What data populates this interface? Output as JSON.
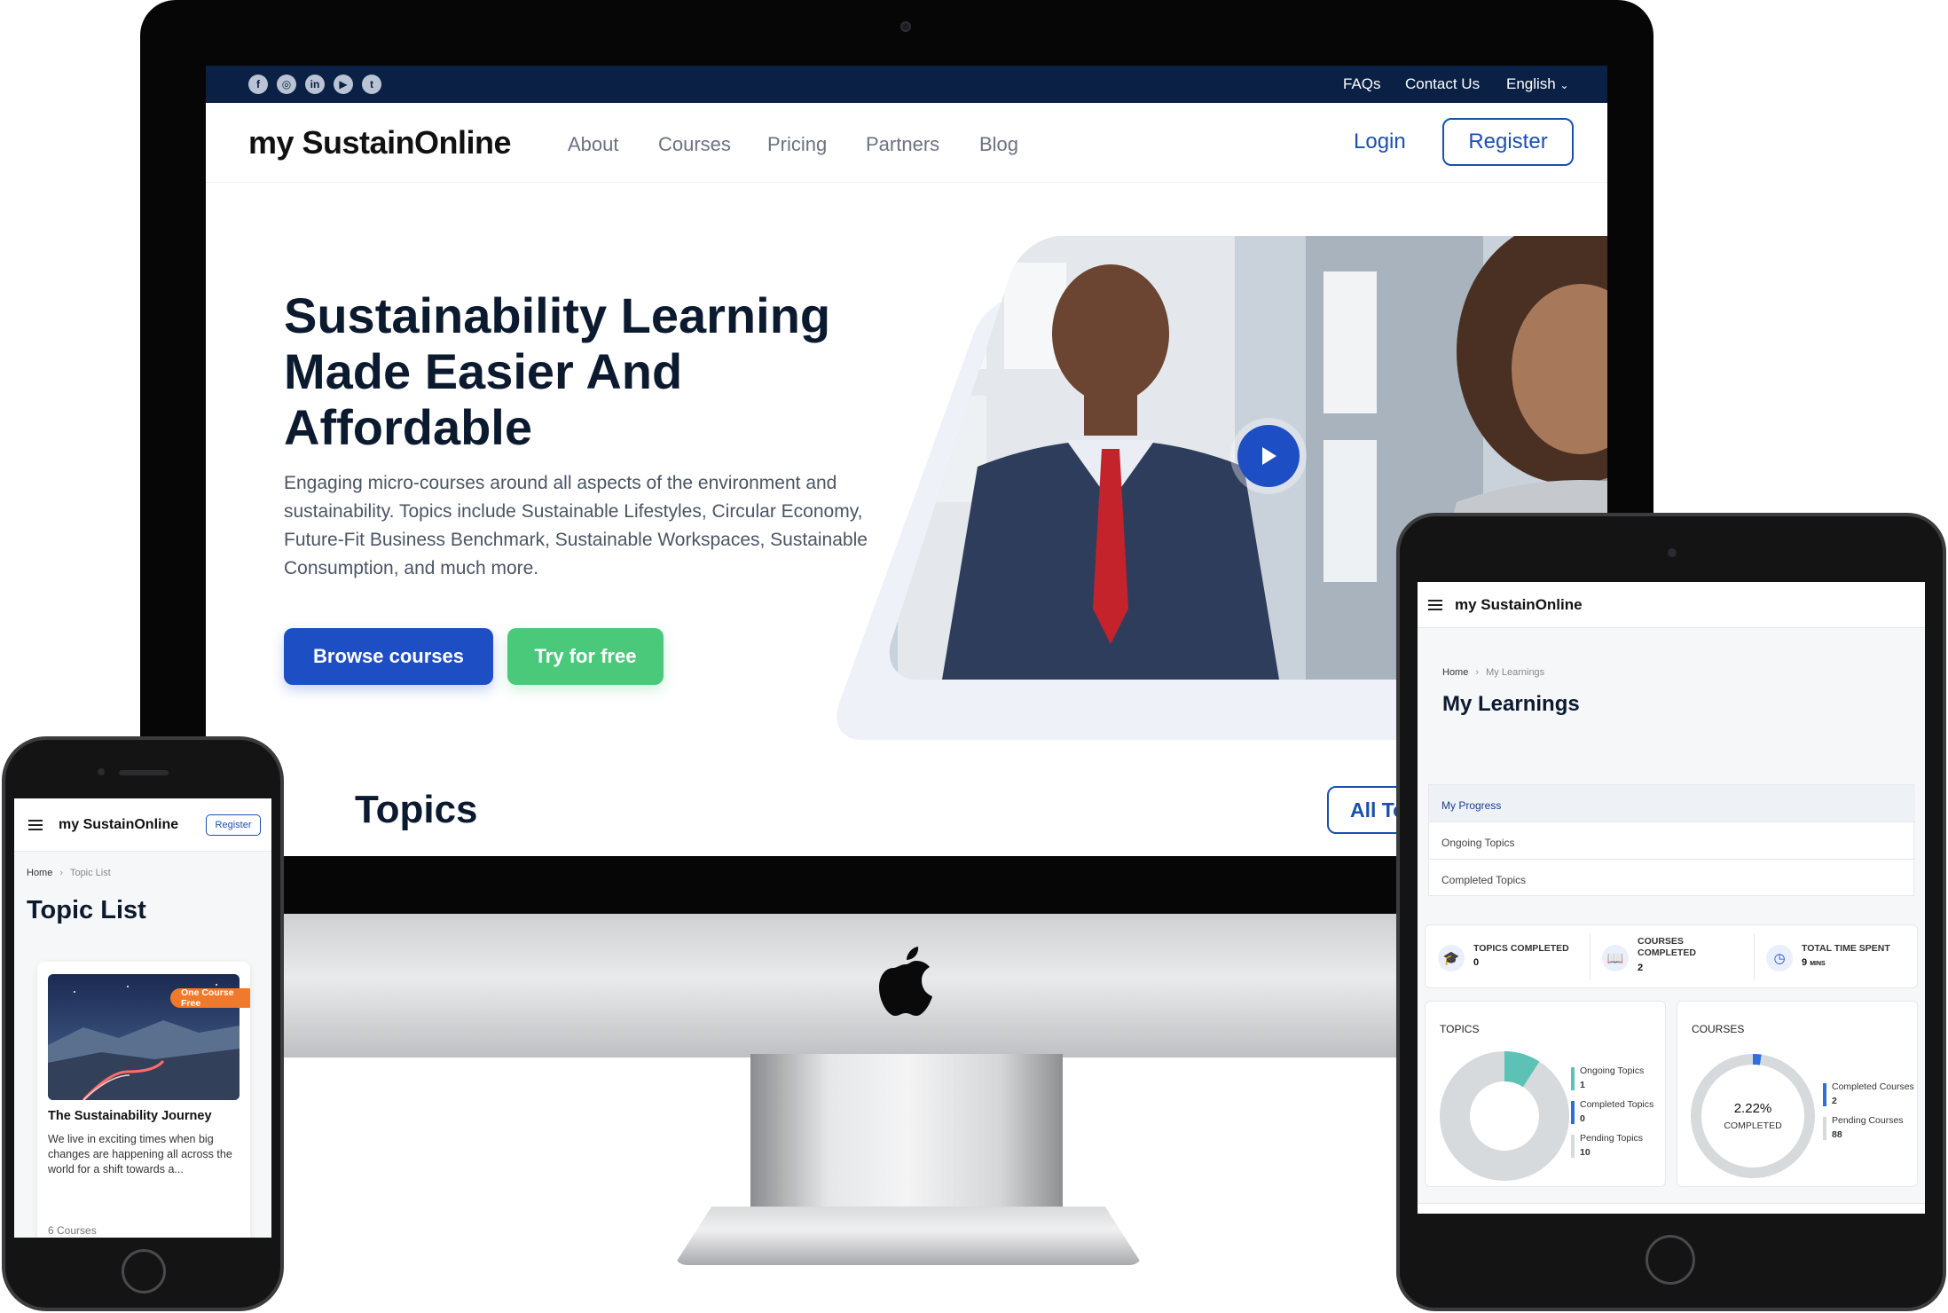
{
  "desktop": {
    "topbar": {
      "social_icons": [
        "facebook-icon",
        "instagram-icon",
        "linkedin-icon",
        "youtube-icon",
        "twitter-icon"
      ],
      "links": [
        "FAQs",
        "Contact Us"
      ],
      "language": "English"
    },
    "nav": {
      "brand": "my SustainOnline",
      "items": [
        "About",
        "Courses",
        "Pricing",
        "Partners",
        "Blog"
      ],
      "login": "Login",
      "register": "Register"
    },
    "hero": {
      "title": "Sustainability Learning Made Easier And Affordable",
      "description": "Engaging micro-courses around all aspects of the environment and sustainability. Topics include Sustainable Lifestyles, Circular Economy, Future-Fit Business Benchmark, Sustainable Workspaces, Sustainable Consumption, and much more.",
      "browse_button": "Browse courses",
      "try_button": "Try for free"
    },
    "topics": {
      "heading": "Topics",
      "all_button": "All To"
    }
  },
  "tablet": {
    "brand": "my SustainOnline",
    "breadcrumb": [
      "Home",
      "My Learnings"
    ],
    "title": "My Learnings",
    "tabs": [
      "My Progress",
      "Ongoing Topics",
      "Completed Topics"
    ],
    "stats": [
      {
        "label": "TOPICS COMPLETED",
        "value": "0",
        "unit": ""
      },
      {
        "label": "COURSES COMPLETED",
        "value": "2",
        "unit": ""
      },
      {
        "label": "TOTAL TIME SPENT",
        "value": "9",
        "unit": "MINS"
      }
    ],
    "topics_card": {
      "title": "TOPICS",
      "legend": [
        {
          "label": "Ongoing Topics",
          "value": "1",
          "color": "#5cc2b5"
        },
        {
          "label": "Completed Topics",
          "value": "0",
          "color": "#2f6fd6"
        },
        {
          "label": "Pending Topics",
          "value": "10",
          "color": "#d6dadd"
        }
      ]
    },
    "courses_card": {
      "title": "COURSES",
      "center_value": "2.22%",
      "center_label": "COMPLETED",
      "legend": [
        {
          "label": "Completed Courses",
          "value": "2",
          "color": "#2f6fd6"
        },
        {
          "label": "Pending Courses",
          "value": "88",
          "color": "#d6dadd"
        }
      ]
    }
  },
  "phone": {
    "brand": "my SustainOnline",
    "register": "Register",
    "breadcrumb": [
      "Home",
      "Topic List"
    ],
    "title": "Topic List",
    "card": {
      "badge": "One Course Free",
      "title": "The Sustainability Journey",
      "description": "We live in exciting times when big changes are happening all across the world for a shift towards a...",
      "count": "6 Courses"
    }
  },
  "chart_data": [
    {
      "type": "pie",
      "title": "TOPICS",
      "categories": [
        "Ongoing Topics",
        "Completed Topics",
        "Pending Topics"
      ],
      "values": [
        1,
        0,
        10
      ]
    },
    {
      "type": "pie",
      "title": "COURSES",
      "categories": [
        "Completed Courses",
        "Pending Courses"
      ],
      "values": [
        2,
        88
      ]
    }
  ]
}
